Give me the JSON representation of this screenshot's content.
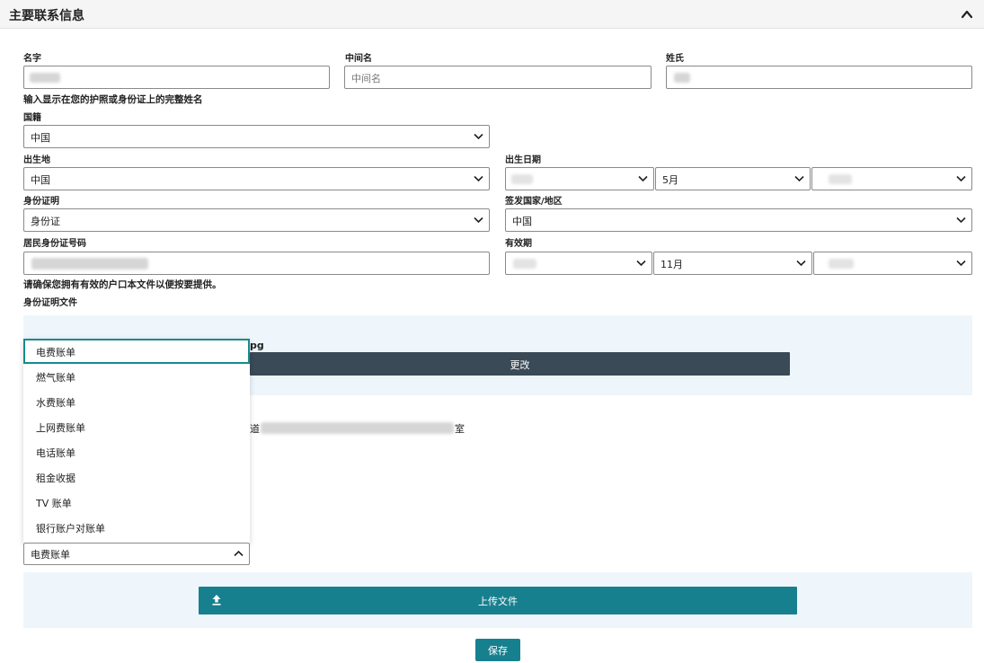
{
  "section": {
    "title": "主要联系信息",
    "collapse_icon": "chevron-up-icon"
  },
  "name": {
    "first_label": "名字",
    "middle_label": "中间名",
    "middle_placeholder": "中间名",
    "last_label": "姓氏",
    "help": "输入显示在您的护照或身份证上的完整姓名"
  },
  "nationality": {
    "label": "国籍",
    "value": "中国"
  },
  "birthplace": {
    "label": "出生地",
    "value": "中国"
  },
  "birthdate": {
    "label": "出生日期",
    "month": "5月"
  },
  "id_type": {
    "label": "身份证明",
    "value": "身份证"
  },
  "issuing_country": {
    "label": "签发国家/地区",
    "value": "中国"
  },
  "id_number": {
    "label": "居民身份证号码"
  },
  "expiry": {
    "label": "有效期",
    "month": "11月"
  },
  "hukou_note": "请确保您拥有有效的户口本文件以便按要提供。",
  "id_doc": {
    "label": "身份证明文件",
    "file_suffix": "pg",
    "change_button": "更改"
  },
  "address": {
    "partial_left": "道",
    "partial_right": "室"
  },
  "doc_type": {
    "options": [
      "电费账单",
      "燃气账单",
      "水费账单",
      "上网费账单",
      "电话账单",
      "租金收据",
      "TV 账单",
      "银行账户对账单"
    ],
    "selected": "电费账单"
  },
  "upload_button": "上传文件",
  "save_button": "保存",
  "colors": {
    "accent": "#17808f",
    "dark_button": "#3a4a57",
    "panel": "#eef6fb"
  }
}
